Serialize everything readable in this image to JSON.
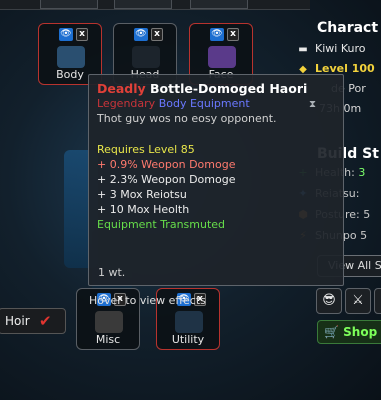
{
  "equipment_slots": [
    {
      "label": "Body",
      "eye": "👁",
      "close": "x",
      "selected": true
    },
    {
      "label": "Head",
      "eye": "👁",
      "close": "x",
      "selected": false
    },
    {
      "label": "Face",
      "eye": "👁",
      "close": "x",
      "selected": true
    },
    {
      "label": "Misc",
      "eye": "👁",
      "close": "x",
      "selected": false
    },
    {
      "label": "Utility",
      "eye": "👁",
      "close": "x",
      "selected": true
    }
  ],
  "character_panel": {
    "title": "Charact",
    "name": "Kiwi Kuro",
    "level": "Level 100",
    "line3": "de Por",
    "line4": "73h 0m"
  },
  "build_stats": {
    "title": "Build St",
    "stats": [
      {
        "icon": "plus-icon",
        "label": "Health:",
        "value": "3"
      },
      {
        "icon": "reiatsu-icon",
        "label": "Reiatsu:",
        "value": ""
      },
      {
        "icon": "posture-icon",
        "label": "Posture:",
        "value": "5"
      },
      {
        "icon": "shunpo-icon",
        "label": "Shunpo",
        "value": "5"
      }
    ],
    "view_all": "View All S"
  },
  "tooltip": {
    "quality": "Deadly",
    "item_name": "Bottle-Domoged Haori",
    "rarity": "Legendary",
    "type": "Body Equipment",
    "description": "Thot guy wos no eosy opponent.",
    "requirement": "Requires Level 85",
    "bonuses": [
      {
        "text": "+ 0.9% Weopon Domoge",
        "color": "red"
      },
      {
        "text": "+ 2.3% Weopon Domoge",
        "color": "white"
      },
      {
        "text": "+ 3 Mox Reiotsu",
        "color": "white"
      },
      {
        "text": "+ 10 Mox Heolth",
        "color": "white"
      }
    ],
    "transmuted": "Equipment Transmuted",
    "weight": "1 wt."
  },
  "hover_hint": "Hover to view effects",
  "hair_button": {
    "label": "Hoir",
    "check": "✔"
  },
  "shop_button": {
    "label": "Shop"
  },
  "colors": {
    "quality_red": "#e04038",
    "rarity_red": "#c8343a",
    "type_blue": "#6a78ff",
    "requirement_yellow": "#e8e64a",
    "bonus_red": "#ff7a6e",
    "transmute_green": "#66dd4a",
    "level_yellow": "#f2d23c"
  }
}
